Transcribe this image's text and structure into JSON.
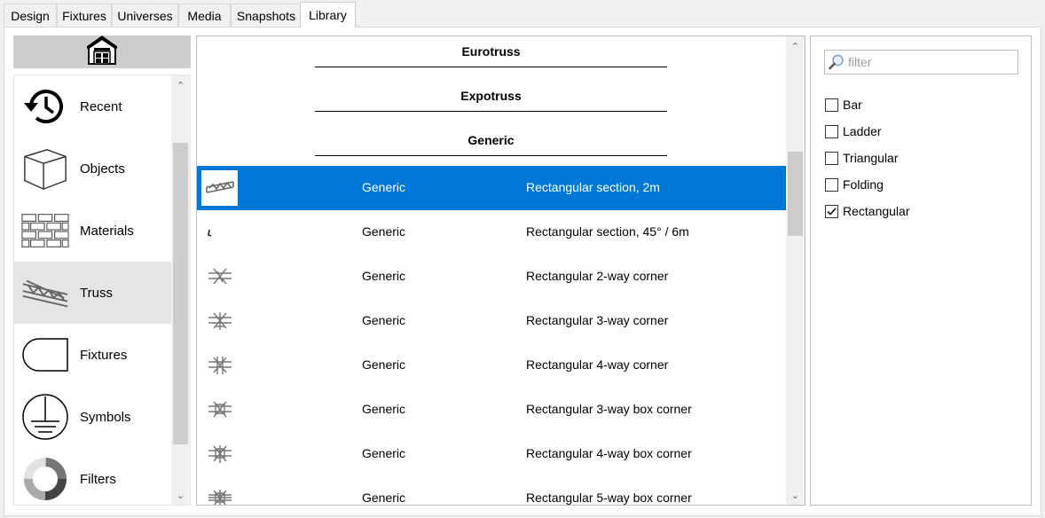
{
  "tabs": [
    {
      "label": "Design"
    },
    {
      "label": "Fixtures"
    },
    {
      "label": "Universes"
    },
    {
      "label": "Media"
    },
    {
      "label": "Snapshots"
    },
    {
      "label": "Library"
    }
  ],
  "active_tab": "Library",
  "categories": [
    {
      "label": "Recent",
      "icon": "clock-history-icon"
    },
    {
      "label": "Objects",
      "icon": "cube-icon"
    },
    {
      "label": "Materials",
      "icon": "brick-wall-icon"
    },
    {
      "label": "Truss",
      "icon": "truss-icon"
    },
    {
      "label": "Fixtures",
      "icon": "fixture-shape-icon"
    },
    {
      "label": "Symbols",
      "icon": "ground-symbol-icon"
    },
    {
      "label": "Filters",
      "icon": "filter-ring-icon"
    }
  ],
  "selected_category": "Truss",
  "groups": [
    {
      "label": "Eurotruss"
    },
    {
      "label": "Expotruss"
    },
    {
      "label": "Generic"
    }
  ],
  "items": [
    {
      "maker": "Generic",
      "desc": "Rectangular section, 2m",
      "selected": true
    },
    {
      "maker": "Generic",
      "desc": "Rectangular section, 45° / 6m"
    },
    {
      "maker": "Generic",
      "desc": "Rectangular 2-way corner"
    },
    {
      "maker": "Generic",
      "desc": "Rectangular 3-way corner"
    },
    {
      "maker": "Generic",
      "desc": "Rectangular 4-way corner"
    },
    {
      "maker": "Generic",
      "desc": "Rectangular 3-way box corner"
    },
    {
      "maker": "Generic",
      "desc": "Rectangular 4-way box corner"
    },
    {
      "maker": "Generic",
      "desc": "Rectangular 5-way box corner"
    }
  ],
  "filter": {
    "placeholder": "filter",
    "value": "",
    "options": [
      {
        "label": "Bar",
        "checked": false
      },
      {
        "label": "Ladder",
        "checked": false
      },
      {
        "label": "Triangular",
        "checked": false
      },
      {
        "label": "Folding",
        "checked": false
      },
      {
        "label": "Rectangular",
        "checked": true
      }
    ]
  },
  "colors": {
    "selection": "#0078d7",
    "category_selected": "#e5e5e5",
    "panel_border": "#bdbdbd"
  }
}
